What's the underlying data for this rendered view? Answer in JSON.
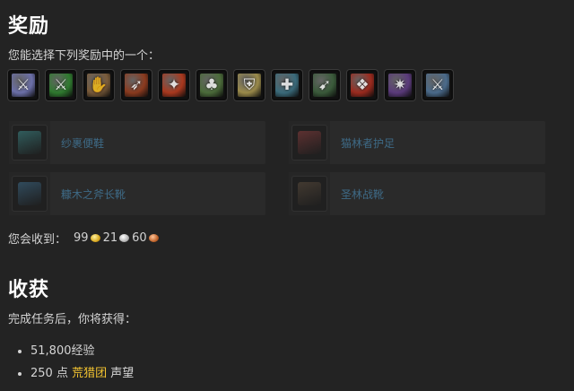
{
  "rewards": {
    "title": "奖励",
    "intro": "您能选择下列奖励中的一个：",
    "icons": [
      {
        "name": "mace-icon",
        "color": "#6b6fa8",
        "glyph": "⚔"
      },
      {
        "name": "green-blade-icon",
        "color": "#2f7a2f",
        "glyph": "⚔"
      },
      {
        "name": "claw-gloves-icon",
        "color": "#7a5b3a",
        "glyph": "✋"
      },
      {
        "name": "bow-icon",
        "color": "#8a3a1e",
        "glyph": "➶"
      },
      {
        "name": "fire-wand-icon",
        "color": "#a8381e",
        "glyph": "✦"
      },
      {
        "name": "pouch-icon",
        "color": "#4b6b3a",
        "glyph": "♣"
      },
      {
        "name": "gold-shield-icon",
        "color": "#9a8a4a",
        "glyph": "⛨"
      },
      {
        "name": "crossbow-icon",
        "color": "#3a6a7a",
        "glyph": "✚"
      },
      {
        "name": "polearm-icon",
        "color": "#3a5a3a",
        "glyph": "➹"
      },
      {
        "name": "red-tabard-icon",
        "color": "#9a2a1e",
        "glyph": "❖"
      },
      {
        "name": "purple-claw-icon",
        "color": "#5a3a7a",
        "glyph": "✷"
      },
      {
        "name": "silver-sword-icon",
        "color": "#4a6a8a",
        "glyph": "⚔"
      }
    ],
    "choices": [
      {
        "label": "纱裹便鞋",
        "color": "#3a8a8a"
      },
      {
        "label": "猫林者护足",
        "color": "#8a3a3a"
      },
      {
        "label": "糠木之斧长靴",
        "color": "#3a6a8a"
      },
      {
        "label": "圣林战靴",
        "color": "#5a4a3a"
      }
    ]
  },
  "money": {
    "label": "您会收到：",
    "gold": "99",
    "silver": "21",
    "copper": "60"
  },
  "gains": {
    "title": "收获",
    "intro": "完成任务后，你将获得：",
    "xp": "51,800经验",
    "rep_prefix": "250 点",
    "rep_faction": "荒猎团",
    "rep_suffix": "声望"
  }
}
